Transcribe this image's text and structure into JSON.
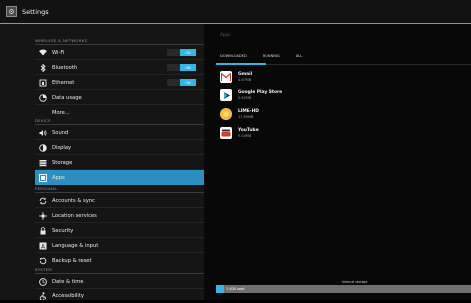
{
  "window": {
    "title": "Settings"
  },
  "sidebar": {
    "section_wireless": "WIRELESS & NETWORKS",
    "section_device": "DEVICE",
    "section_personal": "PERSONAL",
    "section_system": "SYSTEM",
    "wifi": {
      "label": "Wi-Fi",
      "toggle": "ON",
      "icon": "wifi-icon"
    },
    "bluetooth": {
      "label": "Bluetooth",
      "toggle": "ON",
      "icon": "bluetooth-icon"
    },
    "ethernet": {
      "label": "Ethernet",
      "toggle": "ON",
      "icon": "ethernet-icon"
    },
    "data_usage": {
      "label": "Data usage",
      "icon": "data-usage-icon"
    },
    "more": {
      "label": "More..."
    },
    "sound": {
      "label": "Sound",
      "icon": "sound-icon"
    },
    "display": {
      "label": "Display",
      "icon": "display-icon"
    },
    "storage": {
      "label": "Storage",
      "icon": "storage-icon"
    },
    "apps": {
      "label": "Apps",
      "icon": "apps-icon"
    },
    "accounts": {
      "label": "Accounts & sync",
      "icon": "sync-icon"
    },
    "location": {
      "label": "Location services",
      "icon": "location-icon"
    },
    "security": {
      "label": "Security",
      "icon": "lock-icon"
    },
    "language": {
      "label": "Language & input",
      "icon": "language-icon"
    },
    "backup": {
      "label": "Backup & reset",
      "icon": "backup-icon"
    },
    "datetime": {
      "label": "Date & time",
      "icon": "clock-icon"
    },
    "accessibility": {
      "label": "Accessibility",
      "icon": "accessibility-icon"
    }
  },
  "main": {
    "title": "Apps",
    "tabs": [
      "DOWNLOADED",
      "RUNNING",
      "ALL"
    ],
    "apps": [
      {
        "name": "Gmail",
        "size": "4.67MB",
        "icon": "gmail-icon",
        "color": "#d23f31"
      },
      {
        "name": "Google Play Store",
        "size": "5.62MB",
        "icon": "play-store-icon",
        "color": "#ffffff"
      },
      {
        "name": "LIME-HD",
        "size": "17.89MB",
        "icon": "lime-hd-icon",
        "color": "#f5c84b"
      },
      {
        "name": "YouTube",
        "size": "9.04MB",
        "icon": "youtube-icon",
        "color": "#ffffff"
      }
    ],
    "storage": {
      "label": "Internal storage",
      "used_label": "1.4GB used",
      "used_fraction": 0.03
    }
  },
  "colors": {
    "accent": "#33b5e5",
    "selected": "#2c8fbf"
  }
}
